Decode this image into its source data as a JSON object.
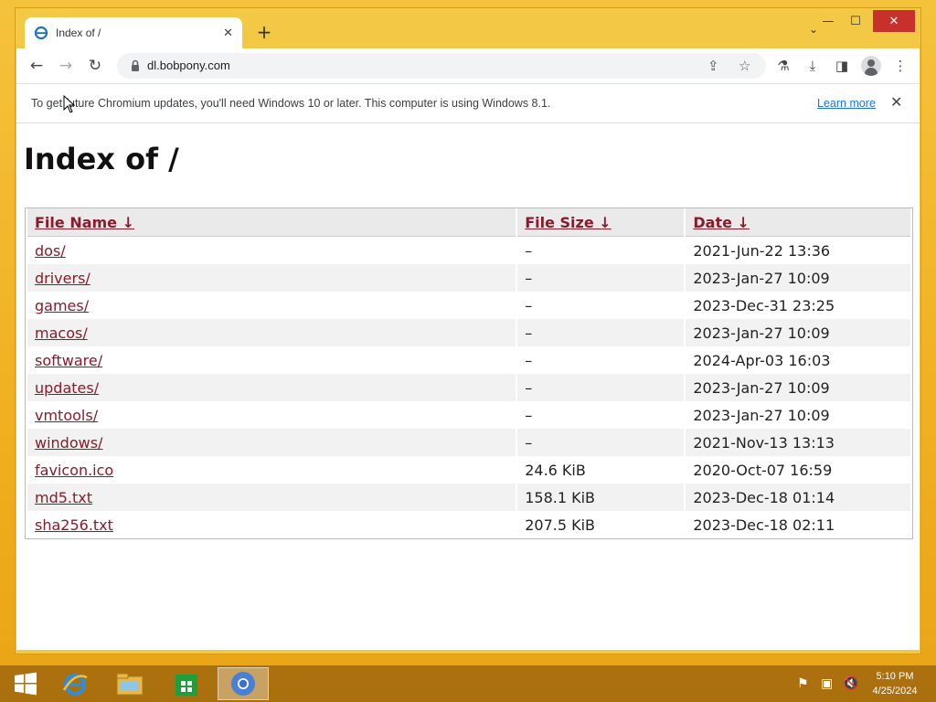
{
  "tab": {
    "title": "Index of /",
    "close": "✕"
  },
  "new_tab": "+",
  "tab_menu": "⌄",
  "caption": {
    "minimize": "—",
    "maximize": "☐",
    "close": "✕"
  },
  "toolbar": {
    "back": "←",
    "forward": "→",
    "reload": "↻",
    "url": "dl.bobpony.com",
    "share": "⇪",
    "star": "☆",
    "labs": "⚗",
    "download": "⤓",
    "sidepanel": "◨",
    "menu": "⋮"
  },
  "infobar": {
    "message": "To get future Chromium updates, you'll need Windows 10 or later. This computer is using Windows 8.1.",
    "learn_more": "Learn more",
    "close": "✕"
  },
  "page": {
    "heading": "Index of /",
    "columns": [
      "File Name  ↓",
      "File Size  ↓",
      "Date  ↓"
    ],
    "rows": [
      {
        "name": "dos/",
        "size": "–",
        "date": "2021-Jun-22 13:36"
      },
      {
        "name": "drivers/",
        "size": "–",
        "date": "2023-Jan-27 10:09"
      },
      {
        "name": "games/",
        "size": "–",
        "date": "2023-Dec-31 23:25"
      },
      {
        "name": "macos/",
        "size": "–",
        "date": "2023-Jan-27 10:09"
      },
      {
        "name": "software/",
        "size": "–",
        "date": "2024-Apr-03 16:03"
      },
      {
        "name": "updates/",
        "size": "–",
        "date": "2023-Jan-27 10:09"
      },
      {
        "name": "vmtools/",
        "size": "–",
        "date": "2023-Jan-27 10:09"
      },
      {
        "name": "windows/",
        "size": "–",
        "date": "2021-Nov-13 13:13"
      },
      {
        "name": "favicon.ico",
        "size": "24.6 KiB",
        "date": "2020-Oct-07 16:59"
      },
      {
        "name": "md5.txt",
        "size": "158.1 KiB",
        "date": "2023-Dec-18 01:14"
      },
      {
        "name": "sha256.txt",
        "size": "207.5 KiB",
        "date": "2023-Dec-18 02:11"
      }
    ]
  },
  "taskbar": {
    "clock_time": "5:10 PM",
    "clock_date": "4/25/2024"
  },
  "colors": {
    "link": "#8b1a2b",
    "accent": "#1a73e8",
    "frame": "#f3c845"
  }
}
